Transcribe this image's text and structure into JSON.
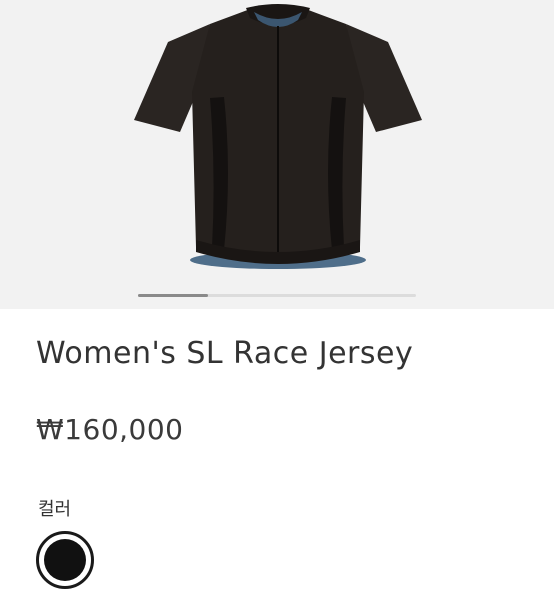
{
  "gallery": {
    "slide_progress": 0.25,
    "image_alt": "jersey-photo"
  },
  "product": {
    "title": "Women's SL Race Jersey",
    "price": "₩160,000"
  },
  "options": {
    "color_label": "컬러",
    "swatch_color": "#111111"
  },
  "colors": {
    "gallery_bg": "#f2f2f2",
    "jersey_body": "#2a2522",
    "jersey_shadow": "#141110",
    "jersey_lining": "#4f6e8a"
  }
}
